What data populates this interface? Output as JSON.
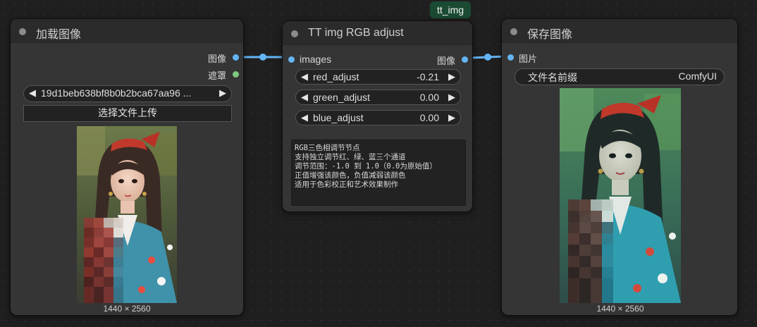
{
  "badge": {
    "label": "tt_img"
  },
  "load_node": {
    "title": "加载图像",
    "outputs": [
      {
        "label": "图像",
        "port_color": "#64b5f6"
      },
      {
        "label": "遮罩",
        "port_color": "#7ec87e"
      }
    ],
    "image_file": "19d1beb638bf8b0b2bca67aa96 ...",
    "upload_button": "选择文件上传",
    "image_dims": "1440 × 2560",
    "image_alt": "portrait of a girl with red bow, kimono, partially pixelated"
  },
  "rgb_node": {
    "title": "TT img RGB adjust",
    "input": {
      "label": "images"
    },
    "output": {
      "label": "图像"
    },
    "params": [
      {
        "name": "red_adjust",
        "value": "-0.21"
      },
      {
        "name": "green_adjust",
        "value": "0.00"
      },
      {
        "name": "blue_adjust",
        "value": "0.00"
      }
    ],
    "description": [
      "RGB三色相调节节点",
      "支持独立调节红、绿、蓝三个通道",
      "调节范围：-1.0 到 1.0（0.0为原始值）",
      "正值增强该颜色，负值减弱该颜色",
      "适用于色彩校正和艺术效果制作"
    ]
  },
  "save_node": {
    "title": "保存图像",
    "input": {
      "label": "图片"
    },
    "filename_prefix": {
      "label": "文件名前缀",
      "value": "ComfyUI"
    },
    "image_dims": "1440 × 2560",
    "image_alt": "color adjusted portrait output"
  },
  "colors": {
    "canvas": "#1f1f1f",
    "node_body": "#353535",
    "node_header": "#2b2b2b",
    "wire": "#64b5f6",
    "badge": "#1b4a33"
  }
}
